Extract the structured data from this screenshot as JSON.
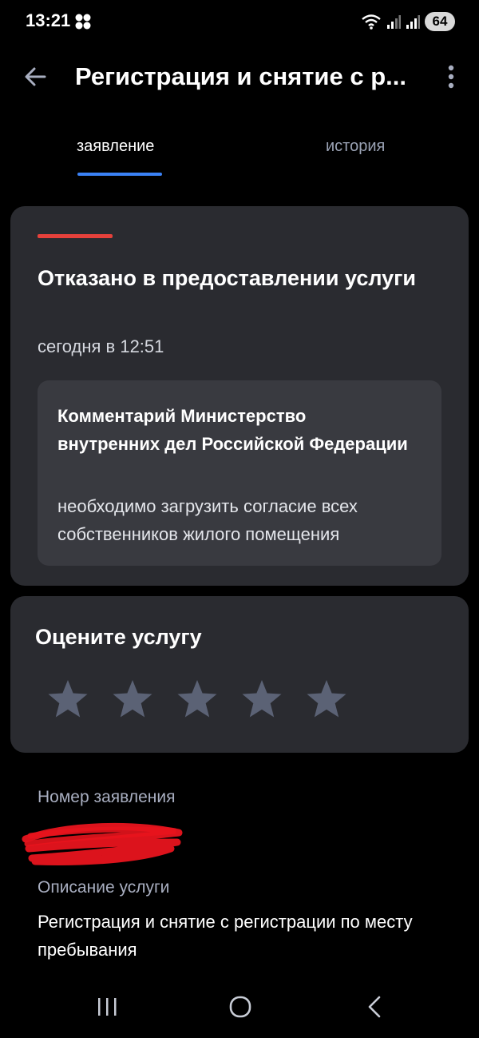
{
  "status_bar": {
    "time": "13:21",
    "battery": "64"
  },
  "app_bar": {
    "title": "Регистрация и снятие с р..."
  },
  "tabs": [
    {
      "label": "заявление",
      "active": true
    },
    {
      "label": "история",
      "active": false
    }
  ],
  "status": {
    "title": "Отказано в предоставлении услуги",
    "date": "сегодня в 12:51",
    "indicator_color": "#e5413b",
    "comment_title": "Комментарий Министерство внутренних дел Российской Федерации",
    "comment_text": "необходимо загрузить согласие всех собственников жилого помещения"
  },
  "rating": {
    "title": "Оцените услугу",
    "max_stars": 5,
    "selected": 0
  },
  "details": {
    "number_label": "Номер заявления",
    "description_label": "Описание услуги",
    "description_text": "Регистрация и снятие с регистрации по месту пребывания"
  },
  "colors": {
    "accent": "#3b82f6",
    "card": "#2a2b30",
    "error": "#e5413b",
    "star": "#5b6275"
  }
}
